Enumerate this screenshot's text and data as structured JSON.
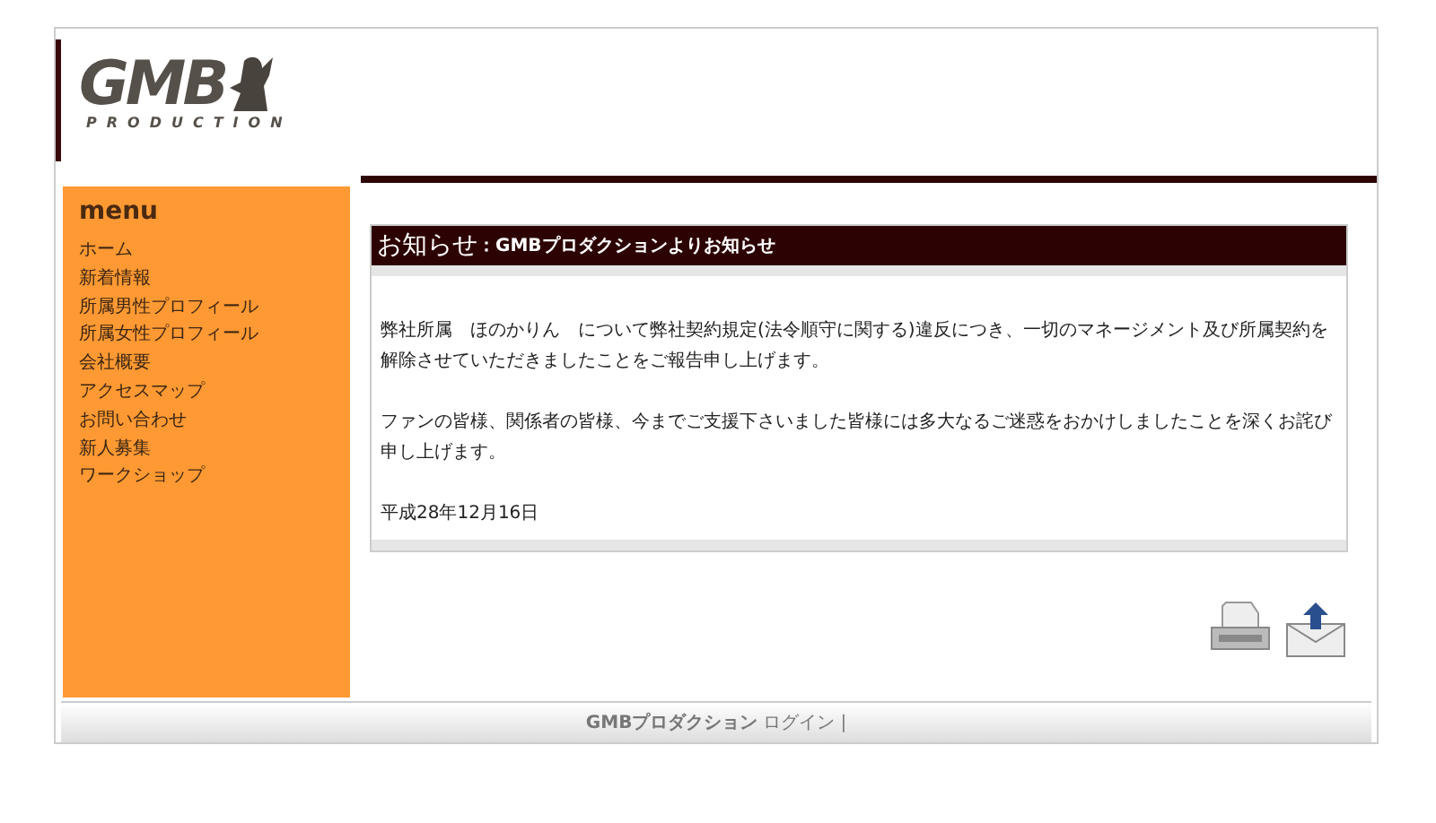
{
  "logo": {
    "mark": "GMB",
    "subtitle": "PRODUCTION"
  },
  "menu": {
    "title": "menu",
    "items": [
      "ホーム",
      "新着情報",
      "所属男性プロフィール",
      "所属女性プロフィール",
      "会社概要",
      "アクセスマップ",
      "お問い合わせ",
      "新人募集",
      "ワークショップ"
    ]
  },
  "notice": {
    "title": "お知らせ",
    "subtitle": "：GMBプロダクションよりお知らせ",
    "paragraphs": [
      "弊社所属　ほのかりん　について弊社契約規定(法令順守に関する)違反につき、一切のマネージメント及び所属契約を解除させていただきましたことをご報告申し上げます。",
      "ファンの皆様、関係者の皆様、今までご支援下さいました皆様には多大なるご迷惑をおかけしましたことを深くお詫び申し上げます。",
      "平成28年12月16日"
    ]
  },
  "footer": {
    "company": "GMBプロダクション",
    "login": "ログイン",
    "separator": "|"
  }
}
